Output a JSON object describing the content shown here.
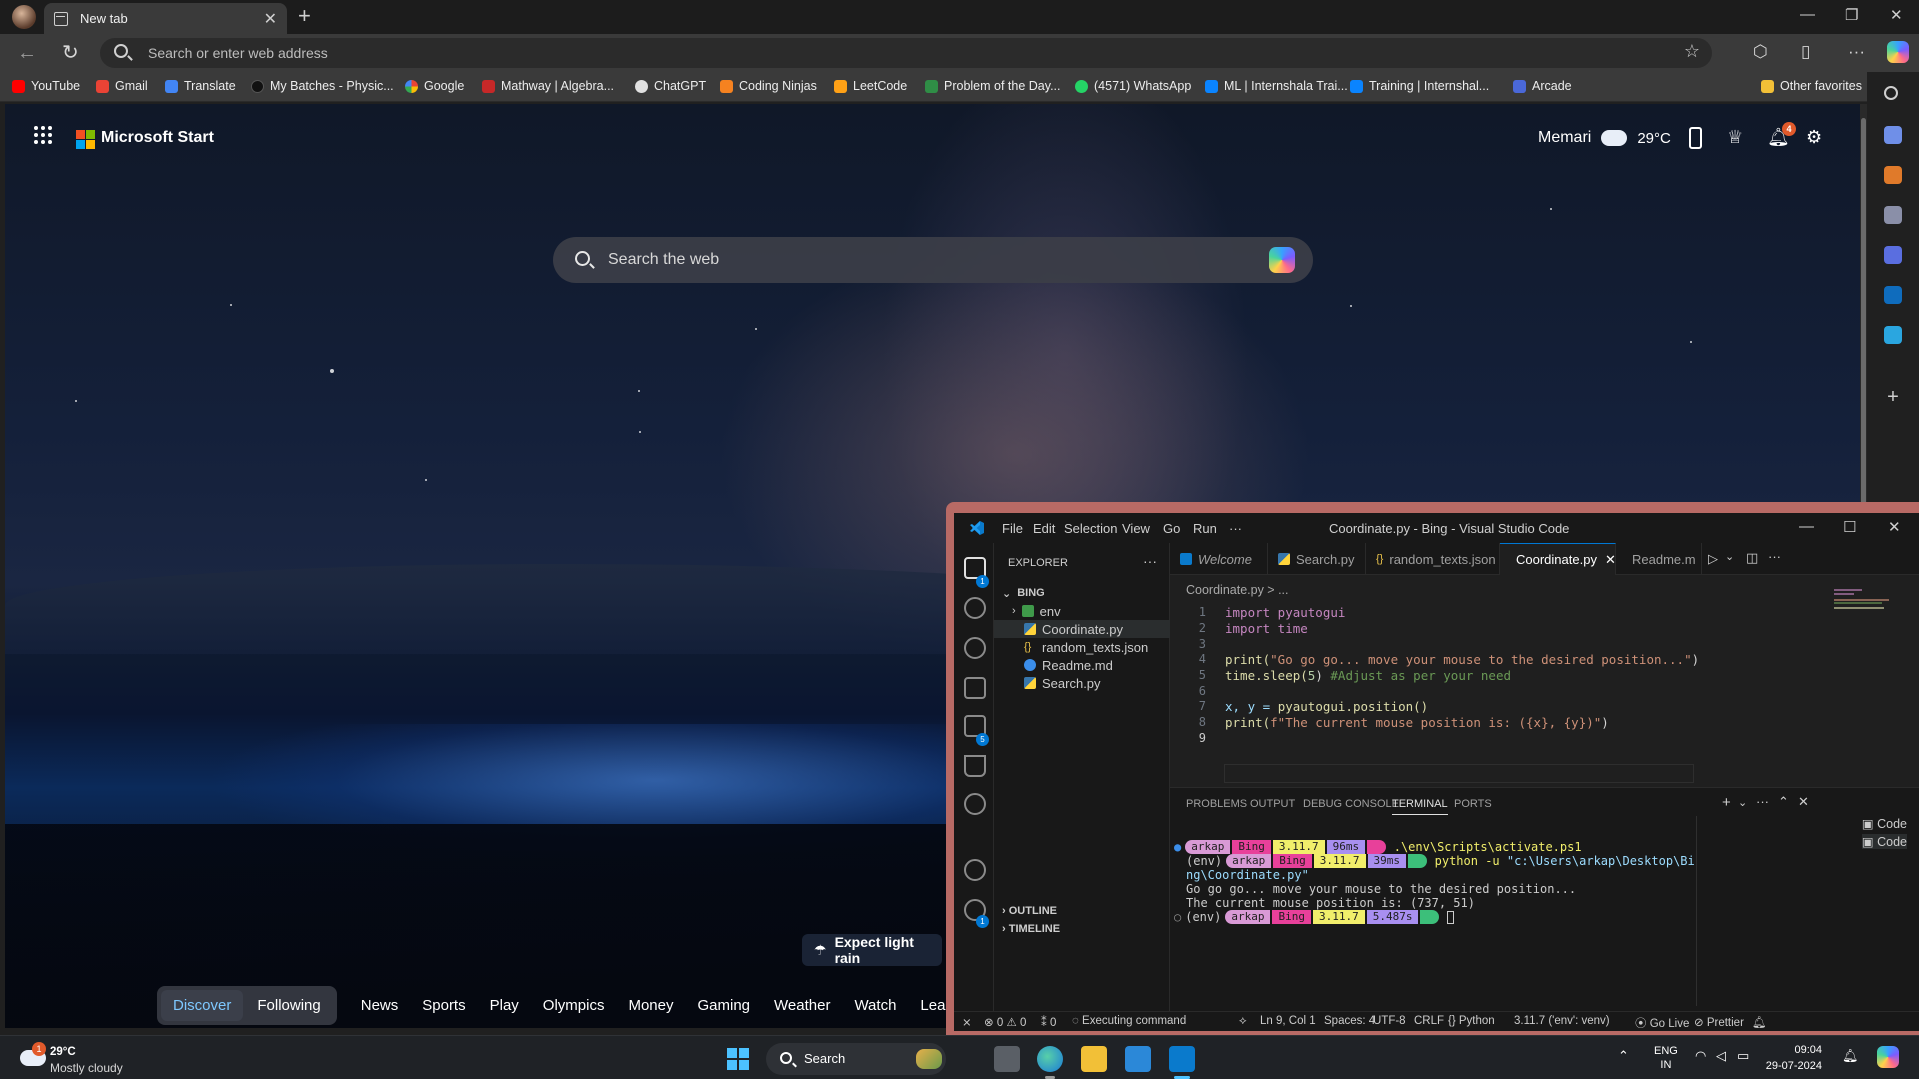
{
  "browser": {
    "tab_title": "New tab",
    "address_placeholder": "Search or enter web address",
    "favorites": [
      {
        "label": "YouTube",
        "color": "#ff0000"
      },
      {
        "label": "Gmail",
        "color": "#ea4335"
      },
      {
        "label": "Translate",
        "color": "#4285f4"
      },
      {
        "label": "My Batches - Physic...",
        "color": "#222222"
      },
      {
        "label": "Google",
        "color": "#ffffff"
      },
      {
        "label": "Mathway | Algebra...",
        "color": "#c62828"
      },
      {
        "label": "ChatGPT",
        "color": "#e0e0e0"
      },
      {
        "label": "Coding Ninjas",
        "color": "#f58220"
      },
      {
        "label": "LeetCode",
        "color": "#ffa116"
      },
      {
        "label": "Problem of the Day...",
        "color": "#2f8d46"
      },
      {
        "label": "(4571) WhatsApp",
        "color": "#25d366"
      },
      {
        "label": "ML | Internshala Trai...",
        "color": "#0a84ff"
      },
      {
        "label": "Training | Internshal...",
        "color": "#0a84ff"
      },
      {
        "label": "Arcade",
        "color": "#4a68d8"
      }
    ],
    "other_favorites": "Other favorites"
  },
  "ntp": {
    "brand": "Microsoft Start",
    "location": "Memari",
    "temperature": "29°C",
    "notification_count": "4",
    "search_placeholder": "Search the web",
    "promo": "Expect light rain",
    "pills": [
      "Discover",
      "Following"
    ],
    "nav_links": [
      "News",
      "Sports",
      "Play",
      "Olympics",
      "Money",
      "Gaming",
      "Weather",
      "Watch",
      "Learning"
    ]
  },
  "vscode": {
    "menu": [
      "File",
      "Edit",
      "Selection",
      "View",
      "Go",
      "Run",
      "···"
    ],
    "window_title": "Coordinate.py - Bing - Visual Studio Code",
    "explorer_label": "EXPLORER",
    "workspace": "BING",
    "tree": [
      {
        "label": "env",
        "kind": "folder"
      },
      {
        "label": "Coordinate.py",
        "kind": "py"
      },
      {
        "label": "random_texts.json",
        "kind": "json"
      },
      {
        "label": "Readme.md",
        "kind": "md"
      },
      {
        "label": "Search.py",
        "kind": "py"
      }
    ],
    "outline": "OUTLINE",
    "timeline": "TIMELINE",
    "tabs": [
      "Welcome",
      "Search.py",
      "random_texts.json",
      "Coordinate.py",
      "Readme.m"
    ],
    "breadcrumb": "Coordinate.py > ...",
    "code": {
      "l1": "import pyautogui",
      "l2": "import time",
      "l4a": "print(",
      "l4b": "\"Go go go... move your mouse to the desired position...\"",
      "l4c": ")",
      "l5a": "time.sleep(",
      "l5b": "5",
      "l5c": ") ",
      "l5d": "#Adjust as per your need",
      "l7a": "x, y = ",
      "l7b": "pyautogui.position()",
      "l8a": "print(",
      "l8b": "f\"The current mouse position is: ({x}, {y})\"",
      "l8c": ")"
    },
    "panel_tabs": [
      "PROBLEMS",
      "OUTPUT",
      "DEBUG CONSOLE",
      "TERMINAL",
      "PORTS"
    ],
    "terminal": {
      "user": "arkap",
      "dir": "Bing",
      "py": "3.11.7",
      "t1": "96ms",
      "cmd1": ".\\env\\Scripts\\activate.ps1",
      "env": "(env)",
      "t2": "39ms",
      "cmd2a": "python -u ",
      "cmd2b": "\"c:\\Users\\arkap\\Desktop\\Bi",
      "cmd2c": "ng\\Coordinate.py\"",
      "out1": "Go go go... move your mouse to the desired position...",
      "out2": "The current mouse position is: (737, 51)",
      "t3": "5.487s",
      "sessions": [
        "Code",
        "Code"
      ]
    },
    "status": {
      "errors": "0",
      "warnings": "0",
      "ports": "0",
      "executing": "Executing command",
      "position": "Ln 9, Col 1",
      "spaces": "Spaces: 4",
      "encoding": "UTF-8",
      "eol": "CRLF",
      "lang": "Python",
      "interpreter": "3.11.7 ('env': venv)",
      "golive": "Go Live",
      "prettier": "Prettier"
    }
  },
  "taskbar": {
    "weather_temp": "29°C",
    "weather_desc": "Mostly cloudy",
    "weather_badge": "1",
    "search": "Search",
    "lang1": "ENG",
    "lang2": "IN",
    "time": "09:04",
    "date": "29-07-2024"
  }
}
